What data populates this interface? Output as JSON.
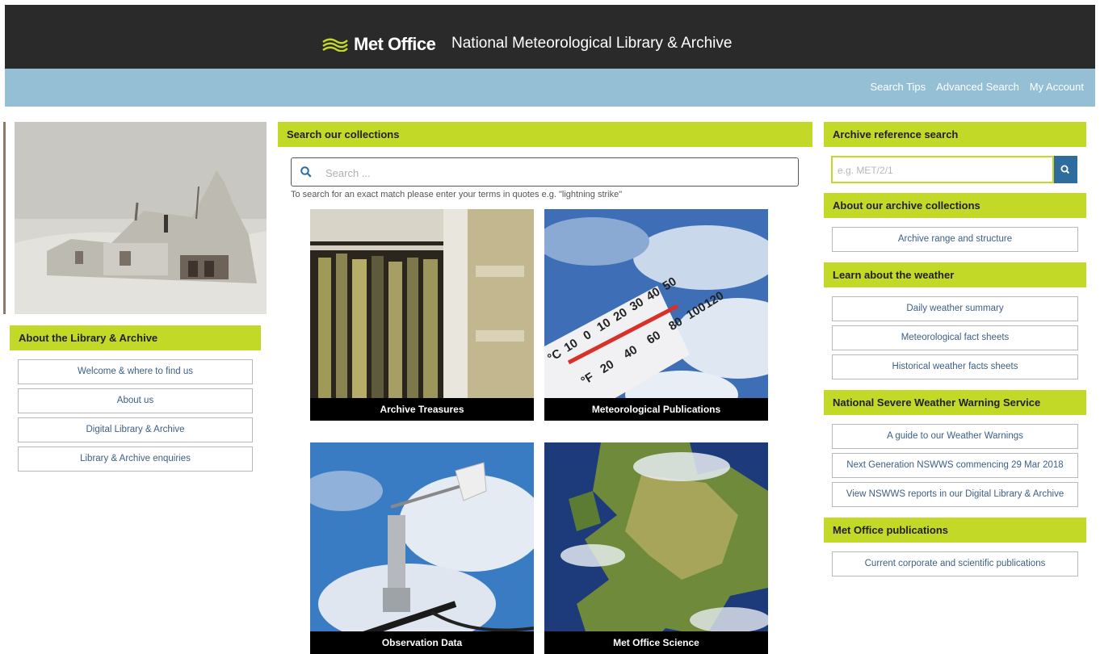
{
  "header": {
    "brand": "Met Office",
    "subtitle": "National Meteorological Library & Archive"
  },
  "subnav": [
    "Search Tips",
    "Advanced Search",
    "My Account"
  ],
  "left": {
    "heading": "About the Library & Archive",
    "links": [
      "Welcome & where to find us",
      "About us",
      "Digital Library & Archive",
      "Library & Archive enquiries"
    ]
  },
  "search": {
    "heading": "Search our collections",
    "placeholder": "Search ...",
    "hint": "To search for an exact match please enter your terms in quotes e.g. \"lightning strike\""
  },
  "tiles": [
    "Archive Treasures",
    "Meteorological Publications",
    "Observation Data",
    "Met Office Science"
  ],
  "right": {
    "archive_ref": {
      "heading": "Archive reference search",
      "placeholder": "e.g. MET/2/1"
    },
    "about_archive": {
      "heading": "About our archive collections",
      "links": [
        "Archive range and structure"
      ]
    },
    "learn": {
      "heading": "Learn about the weather",
      "links": [
        "Daily weather summary",
        "Meteorological fact sheets",
        "Historical weather facts sheets"
      ]
    },
    "nswws": {
      "heading": "National Severe Weather Warning Service",
      "links": [
        "A guide to our Weather Warnings",
        "Next Generation NSWWS commencing 29 Mar 2018",
        "View NSWWS reports in our Digital Library & Archive"
      ]
    },
    "publications": {
      "heading": "Met Office publications",
      "links": [
        "Current corporate and scientific publications"
      ]
    }
  },
  "thermometer_scale": [
    "120",
    "100",
    "80",
    "60",
    "40",
    "20",
    "50",
    "40",
    "30",
    "20",
    "10",
    "0",
    "10",
    "°C",
    "°F"
  ],
  "colors": {
    "accent_green": "#c3d928",
    "header_dark": "#2a2a2a",
    "subbar_blue": "#94bfd5",
    "link_blue": "#3d5f86",
    "button_blue": "#2d6c9c"
  }
}
